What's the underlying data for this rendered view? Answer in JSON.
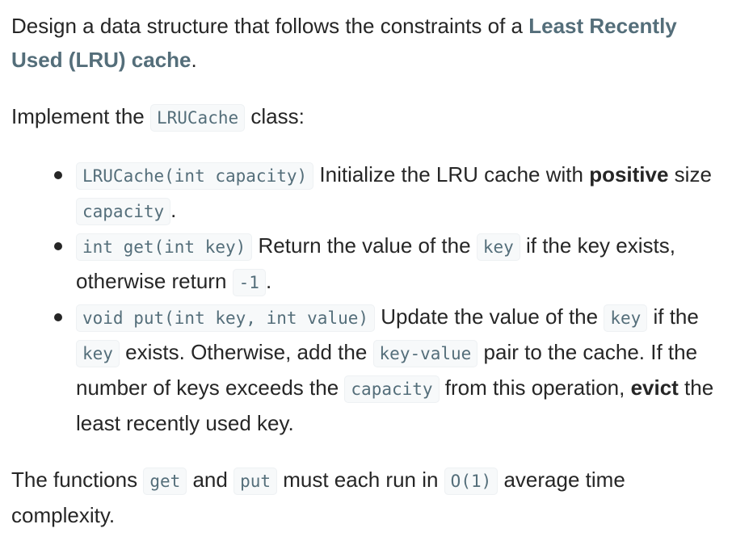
{
  "intro": {
    "text": "Design a data structure that follows the constraints of a ",
    "link": "Least Recently Used (LRU) cache",
    "end": "."
  },
  "implement": {
    "pre": "Implement the ",
    "code": "LRUCache",
    "post": " class:"
  },
  "items": [
    {
      "code": "LRUCache(int capacity)",
      "t1": " Initialize the LRU cache with ",
      "bold": "positive",
      "t2": " size ",
      "code2": "capacity",
      "t3": "."
    },
    {
      "code": "int get(int key)",
      "t1": " Return the value of the ",
      "code2": "key",
      "t2": " if the key exists, otherwise return ",
      "code3": "-1",
      "t3": "."
    },
    {
      "code": "void put(int key, int value)",
      "t1": " Update the value of the ",
      "code2": "key",
      "t2": " if the ",
      "code3": "key",
      "t3": " exists. Otherwise, add the ",
      "code4": "key-value",
      "t4": " pair to the cache. If the number of keys exceeds the ",
      "code5": "capacity",
      "t5": " from this operation, ",
      "bold": "evict",
      "t6": " the least recently used key."
    }
  ],
  "final": {
    "t1": "The functions ",
    "code1": "get",
    "t2": " and ",
    "code2": "put",
    "t3": " must each run in ",
    "code3": "O(1)",
    "t4": " average time complexity."
  }
}
